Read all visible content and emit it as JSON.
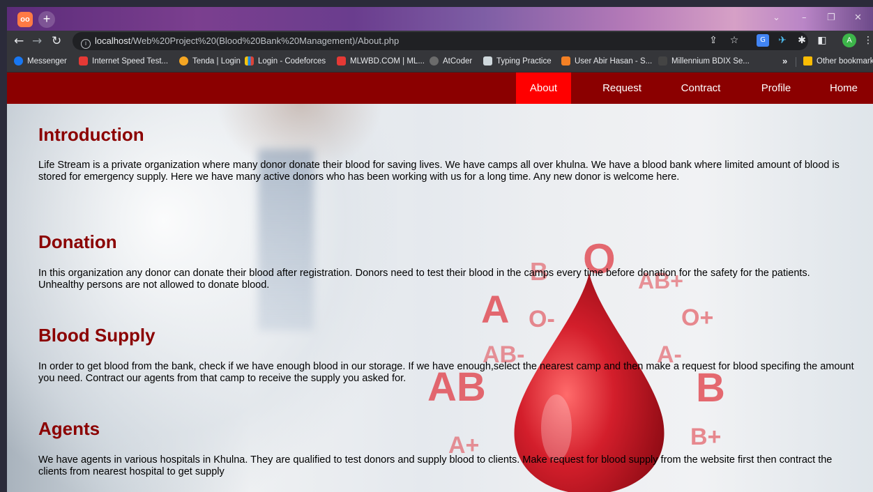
{
  "browser": {
    "tab_favicon": "oo",
    "new_tab": "+",
    "window_controls": [
      "⌄",
      "–",
      "❐",
      "✕"
    ],
    "url_host": "localhost",
    "url_path": "/Web%20Project%20(Blood%20Bank%20Management)/About.php",
    "profile_letter": "A",
    "bookmarks": [
      {
        "label": "Messenger",
        "color": "#1877f2"
      },
      {
        "label": "Internet Speed Test...",
        "color": "#e53935"
      },
      {
        "label": "Tenda | Login",
        "color": "#f5a623"
      },
      {
        "label": "Login - Codeforces",
        "color": "#1e88e5"
      },
      {
        "label": "MLWBD.COM | ML...",
        "color": "#e53935"
      },
      {
        "label": "AtCoder",
        "color": "#6b6b6b"
      },
      {
        "label": "Typing Practice",
        "color": "#cfd8dc"
      },
      {
        "label": "User Abir Hasan - S...",
        "color": "#f48024"
      },
      {
        "label": "Millennium BDIX Se...",
        "color": "#444444"
      }
    ],
    "more_bookmarks": "»",
    "other_bookmarks": "Other bookmarks"
  },
  "nav": {
    "items": [
      {
        "label": "About",
        "active": true
      },
      {
        "label": "Request",
        "active": false
      },
      {
        "label": "Contract",
        "active": false
      },
      {
        "label": "Profile",
        "active": false
      },
      {
        "label": "Home",
        "active": false
      }
    ]
  },
  "background_text": [
    "O",
    "B",
    "AB+",
    "A",
    "O-",
    "O+",
    "AB-",
    "A-",
    "AB",
    "B",
    "A+",
    "B+"
  ],
  "sections": [
    {
      "title": "Introduction",
      "text": "Life Stream is a private organization where many donor donate their blood for saving lives. We have camps all over khulna. We have a blood bank where limited amount of blood is stored for emergency supply. Here we have many active donors who has been working with us for a long time. Any new donor is welcome here."
    },
    {
      "title": "Donation",
      "text": "In this organization any donor can donate their blood after registration. Donors need to test their blood in the camps every time before donation for the safety for the patients. Unhealthy persons are not allowed to donate blood."
    },
    {
      "title": "Blood Supply",
      "text": "In order to get blood from the bank, check if we have enough blood in our storage. If we have enough,select the nearest camp and then make a request for blood specifing the amount you need. Contract our agents from that camp to receive the supply you asked for."
    },
    {
      "title": "Agents",
      "text": "We have agents in various hospitals in Khulna. They are qualified to test donors and supply blood to clients. Make request for blood supply from the website first then contract the clients from nearest hospital to get supply"
    }
  ],
  "colors": {
    "nav_bg": "#8b0000",
    "nav_active": "#ff0000",
    "heading": "#8b0000"
  }
}
